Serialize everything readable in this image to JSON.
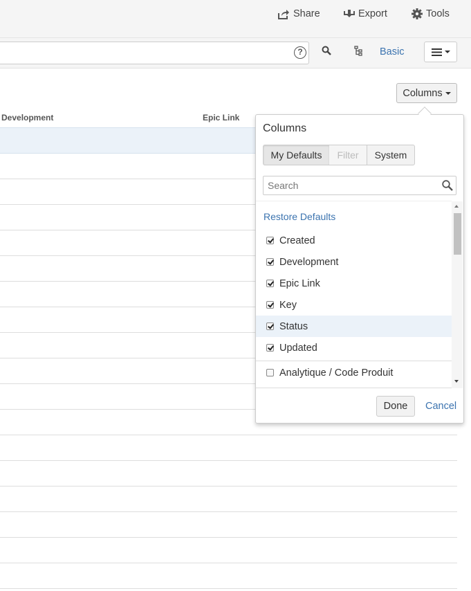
{
  "header": {
    "share_label": "Share",
    "export_label": "Export",
    "tools_label": "Tools"
  },
  "search_bar": {
    "jql_value": "",
    "help_glyph": "?",
    "basic_label": "Basic"
  },
  "results": {
    "columns_button_label": "Columns",
    "headers": [
      "Development",
      "Epic Link"
    ]
  },
  "columns_popover": {
    "title": "Columns",
    "tabs": [
      "My Defaults",
      "Filter",
      "System"
    ],
    "active_tab": "My Defaults",
    "search_placeholder": "Search",
    "restore_defaults_label": "Restore Defaults",
    "checked_items": [
      {
        "label": "Created",
        "checked": true
      },
      {
        "label": "Development",
        "checked": true
      },
      {
        "label": "Epic Link",
        "checked": true
      },
      {
        "label": "Key",
        "checked": true
      },
      {
        "label": "Status",
        "checked": true
      },
      {
        "label": "Updated",
        "checked": true
      }
    ],
    "other_items": [
      {
        "label": "Analytique / Code Produit",
        "checked": false
      }
    ],
    "done_label": "Done",
    "cancel_label": "Cancel"
  },
  "colors": {
    "link": "#3b73af",
    "selected_row": "#ebf2f9"
  },
  "icons": [
    "share-icon",
    "export-icon",
    "gear-icon",
    "help-icon",
    "search-icon",
    "hierarchy-icon",
    "hamburger-icon"
  ]
}
